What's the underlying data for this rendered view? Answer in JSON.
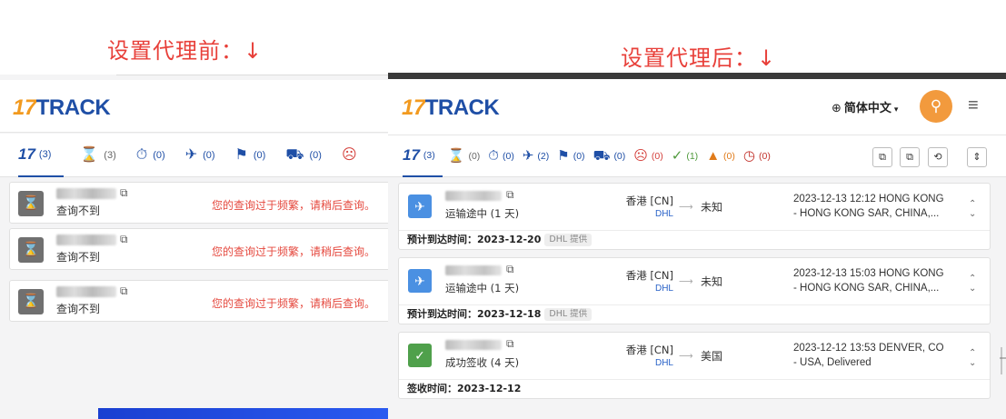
{
  "captions": {
    "before": "设置代理前：↓",
    "after": "设置代理后：↓"
  },
  "logo": {
    "num": "17",
    "text": "TRACK"
  },
  "before": {
    "tabs": [
      {
        "icon": "17",
        "count": "(3)"
      },
      {
        "icon": "⌛",
        "count": "(3)"
      },
      {
        "icon": "⏱",
        "count": "(0)"
      },
      {
        "icon": "✈",
        "count": "(0)"
      },
      {
        "icon": "⚑",
        "count": "(0)"
      },
      {
        "icon": "⛟",
        "count": "(0)"
      },
      {
        "icon": "☹",
        "count": ""
      }
    ],
    "rows": [
      {
        "status": "查询不到",
        "message": "您的查询过于频繁，请稍后查询。"
      },
      {
        "status": "查询不到",
        "message": "您的查询过于频繁，请稍后查询。"
      },
      {
        "status": "查询不到",
        "message": "您的查询过于频繁，请稍后查询。"
      }
    ]
  },
  "after": {
    "language": "简体中文",
    "tabs": [
      {
        "icon": "17",
        "count": "(3)"
      },
      {
        "icon": "⌛",
        "count": "(0)"
      },
      {
        "icon": "⏱",
        "count": "(0)"
      },
      {
        "icon": "✈",
        "count": "(2)"
      },
      {
        "icon": "⚑",
        "count": "(0)"
      },
      {
        "icon": "⛟",
        "count": "(0)"
      },
      {
        "icon": "☹",
        "count": "(0)"
      },
      {
        "icon": "✓",
        "count": "(1)"
      },
      {
        "icon": "▲",
        "count": "(0)"
      },
      {
        "icon": "◷",
        "count": "(0)"
      }
    ],
    "cards": [
      {
        "status": "运输途中 (1 天)",
        "origin": "香港 [CN]",
        "carrier": "DHL",
        "destination": "未知",
        "event_line1": "2023-12-13 12:12 HONG KONG",
        "event_line2": "- HONG KONG SAR, CHINA,...",
        "footer_label": "预计到达时间：2023-12-20",
        "footer_pill": "DHL 提供"
      },
      {
        "status": "运输途中 (1 天)",
        "origin": "香港 [CN]",
        "carrier": "DHL",
        "destination": "未知",
        "event_line1": "2023-12-13 15:03 HONG KONG",
        "event_line2": "- HONG KONG SAR, CHINA,...",
        "footer_label": "预计到达时间：2023-12-18",
        "footer_pill": "DHL 提供"
      },
      {
        "status": "成功签收 (4 天)",
        "origin": "香港 [CN]",
        "carrier": "DHL",
        "destination": "美国",
        "event_line1": "2023-12-12 13:53 DENVER, CO",
        "event_line2": "- USA, Delivered",
        "footer_label": "签收时间：2023-12-12",
        "footer_pill": ""
      }
    ]
  }
}
